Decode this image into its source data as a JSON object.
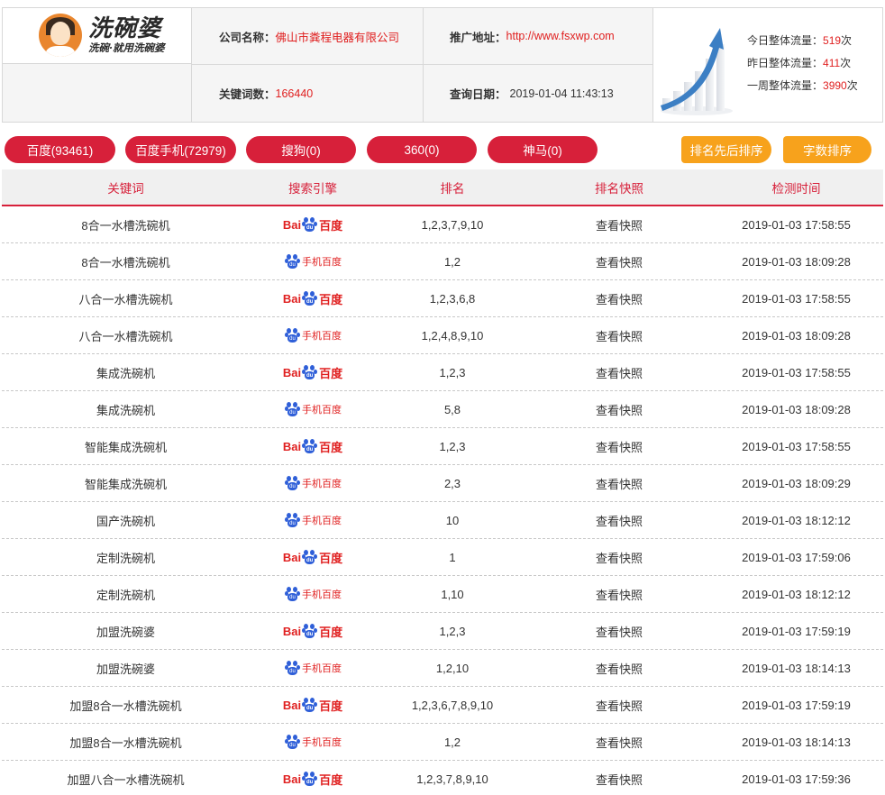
{
  "header": {
    "brand_title": "洗碗婆",
    "brand_slogan": "洗碗·就用洗碗婆",
    "company_label": "公司名称：",
    "company_value": "佛山市粪程电器有限公司",
    "url_label": "推广地址：",
    "url_value": "http://www.fsxwp.com",
    "keywords_label": "关键词数：",
    "keywords_value": "166440",
    "query_date_label": "查询日期：",
    "query_date_value": "2019-01-04 11:43:13"
  },
  "traffic": {
    "today_label": "今日整体流量：",
    "today_value": "519",
    "yesterday_label": "昨日整体流量：",
    "yesterday_value": "411",
    "week_label": "一周整体流量：",
    "week_value": "3990",
    "unit": "次"
  },
  "tabs": [
    {
      "label": "百度(93461)"
    },
    {
      "label": "百度手机(72979)"
    },
    {
      "label": "搜狗(0)"
    },
    {
      "label": "360(0)"
    },
    {
      "label": "神马(0)"
    }
  ],
  "sort_buttons": {
    "rank_sort": "排名先后排序",
    "length_sort": "字数排序"
  },
  "table": {
    "columns": [
      "关键词",
      "搜索引擎",
      "排名",
      "排名快照",
      "检测时间"
    ],
    "engine_labels": {
      "baidu_left": "Bai",
      "baidu_right": "百度",
      "paw_text": "du",
      "mobile": "手机百度"
    },
    "rows": [
      {
        "keyword": "8合一水槽洗碗机",
        "engine": "baidu",
        "rank": "1,2,3,7,9,10",
        "snapshot": "查看快照",
        "time": "2019-01-03 17:58:55"
      },
      {
        "keyword": "8合一水槽洗碗机",
        "engine": "mobile",
        "rank": "1,2",
        "snapshot": "查看快照",
        "time": "2019-01-03 18:09:28"
      },
      {
        "keyword": "八合一水槽洗碗机",
        "engine": "baidu",
        "rank": "1,2,3,6,8",
        "snapshot": "查看快照",
        "time": "2019-01-03 17:58:55"
      },
      {
        "keyword": "八合一水槽洗碗机",
        "engine": "mobile",
        "rank": "1,2,4,8,9,10",
        "snapshot": "查看快照",
        "time": "2019-01-03 18:09:28"
      },
      {
        "keyword": "集成洗碗机",
        "engine": "baidu",
        "rank": "1,2,3",
        "snapshot": "查看快照",
        "time": "2019-01-03 17:58:55"
      },
      {
        "keyword": "集成洗碗机",
        "engine": "mobile",
        "rank": "5,8",
        "snapshot": "查看快照",
        "time": "2019-01-03 18:09:28"
      },
      {
        "keyword": "智能集成洗碗机",
        "engine": "baidu",
        "rank": "1,2,3",
        "snapshot": "查看快照",
        "time": "2019-01-03 17:58:55"
      },
      {
        "keyword": "智能集成洗碗机",
        "engine": "mobile",
        "rank": "2,3",
        "snapshot": "查看快照",
        "time": "2019-01-03 18:09:29"
      },
      {
        "keyword": "国产洗碗机",
        "engine": "mobile",
        "rank": "10",
        "snapshot": "查看快照",
        "time": "2019-01-03 18:12:12"
      },
      {
        "keyword": "定制洗碗机",
        "engine": "baidu",
        "rank": "1",
        "snapshot": "查看快照",
        "time": "2019-01-03 17:59:06"
      },
      {
        "keyword": "定制洗碗机",
        "engine": "mobile",
        "rank": "1,10",
        "snapshot": "查看快照",
        "time": "2019-01-03 18:12:12"
      },
      {
        "keyword": "加盟洗碗婆",
        "engine": "baidu",
        "rank": "1,2,3",
        "snapshot": "查看快照",
        "time": "2019-01-03 17:59:19"
      },
      {
        "keyword": "加盟洗碗婆",
        "engine": "mobile",
        "rank": "1,2,10",
        "snapshot": "查看快照",
        "time": "2019-01-03 18:14:13"
      },
      {
        "keyword": "加盟8合一水槽洗碗机",
        "engine": "baidu",
        "rank": "1,2,3,6,7,8,9,10",
        "snapshot": "查看快照",
        "time": "2019-01-03 17:59:19"
      },
      {
        "keyword": "加盟8合一水槽洗碗机",
        "engine": "mobile",
        "rank": "1,2",
        "snapshot": "查看快照",
        "time": "2019-01-03 18:14:13"
      },
      {
        "keyword": "加盟八合一水槽洗碗机",
        "engine": "baidu",
        "rank": "1,2,3,7,8,9,10",
        "snapshot": "查看快照",
        "time": "2019-01-03 17:59:36"
      }
    ]
  }
}
